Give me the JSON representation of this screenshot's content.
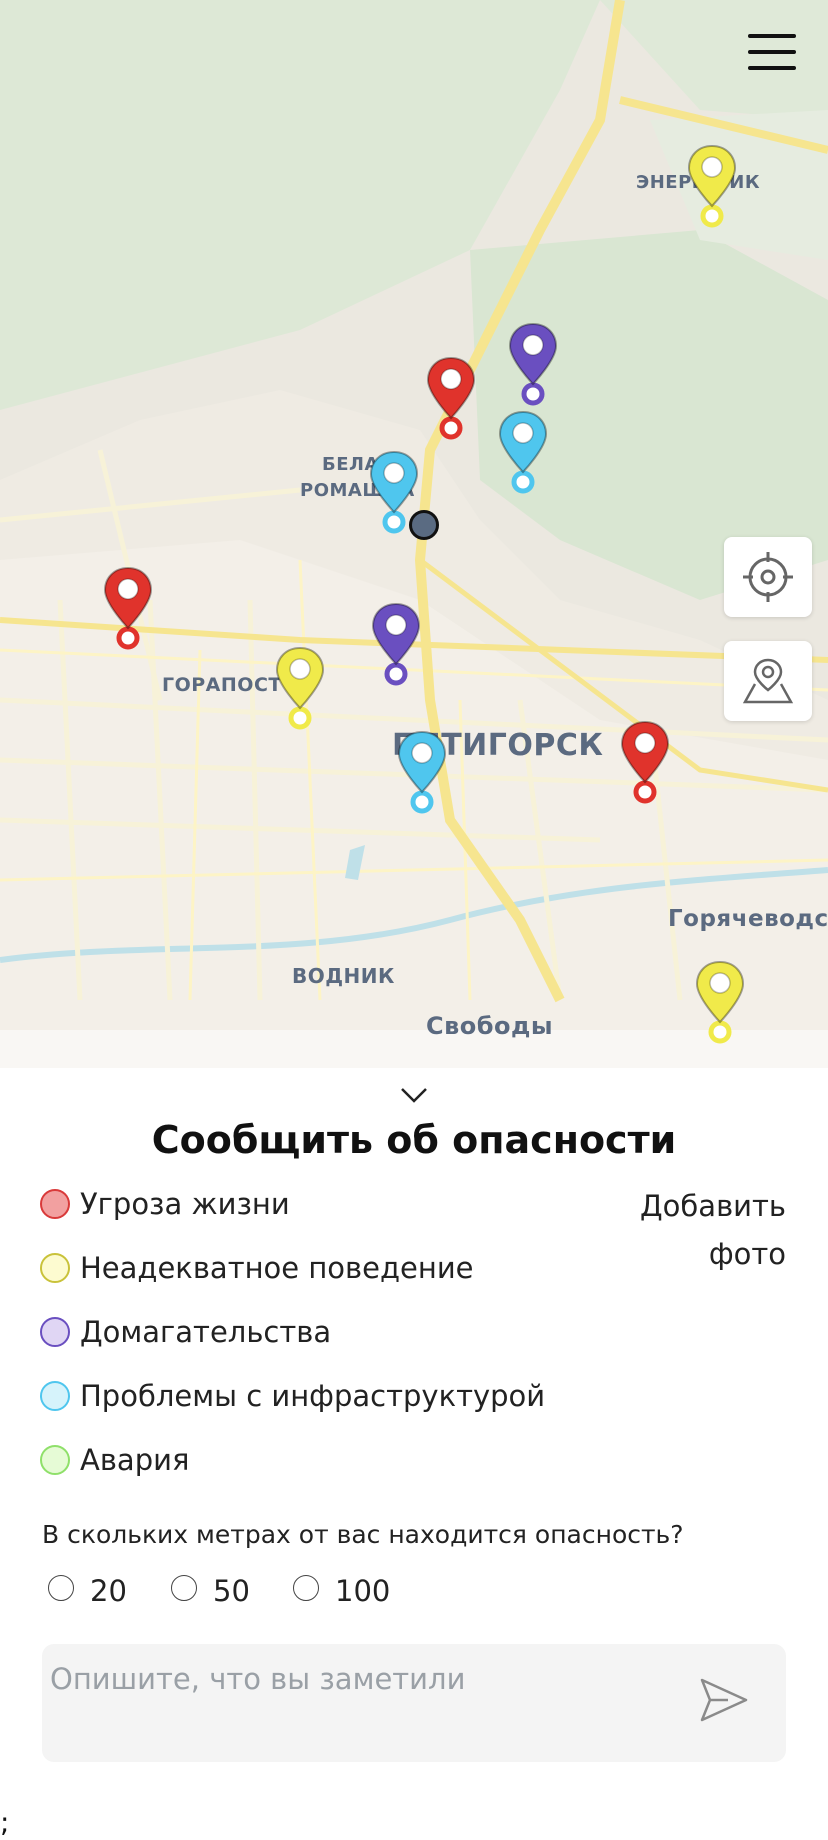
{
  "map": {
    "places": [
      "ЭНЕРГЕТИК",
      "БЕЛАЯ",
      "РОМАШКА",
      "ГОРАПОСТ",
      "ПЯТИГОРСК",
      "Горячеводский",
      "ВОДНИК",
      "Свободы"
    ],
    "pins": [
      {
        "category": "Угроза жизни",
        "color": "#e0332c"
      },
      {
        "category": "Неадекватное поведение",
        "color": "#f0ea4a"
      },
      {
        "category": "Домогательства",
        "color": "#6a4fc0"
      },
      {
        "category": "Проблемы с инфраструктурой",
        "color": "#4fc6ee"
      }
    ],
    "buttons": {
      "locate_icon": "crosshair-icon",
      "pick_icon": "map-pin-icon",
      "menu_icon": "hamburger-menu-icon"
    }
  },
  "sheet": {
    "title": "Сообщить об опасности",
    "categories": [
      {
        "label": "Угроза жизни",
        "color": "#f2a0a0",
        "border": "#d93a3a"
      },
      {
        "label": "Неадекватное поведение",
        "color": "#fdfbd0",
        "border": "#c9c23a"
      },
      {
        "label": "Домагательства",
        "color": "#e0d6f4",
        "border": "#6a4fc0"
      },
      {
        "label": "Проблемы с инфраструктурой",
        "color": "#d6f3fb",
        "border": "#4fc6ee"
      },
      {
        "label": "Авария",
        "color": "#e6fbd6",
        "border": "#8fe06a"
      }
    ],
    "add_photo": "Добавить фото",
    "distance_question": "В скольких метрах от вас находится опасность?",
    "distances": [
      "20",
      "50",
      "100"
    ],
    "message_placeholder": "Опишите, что вы заметили"
  },
  "footer_text": ";"
}
